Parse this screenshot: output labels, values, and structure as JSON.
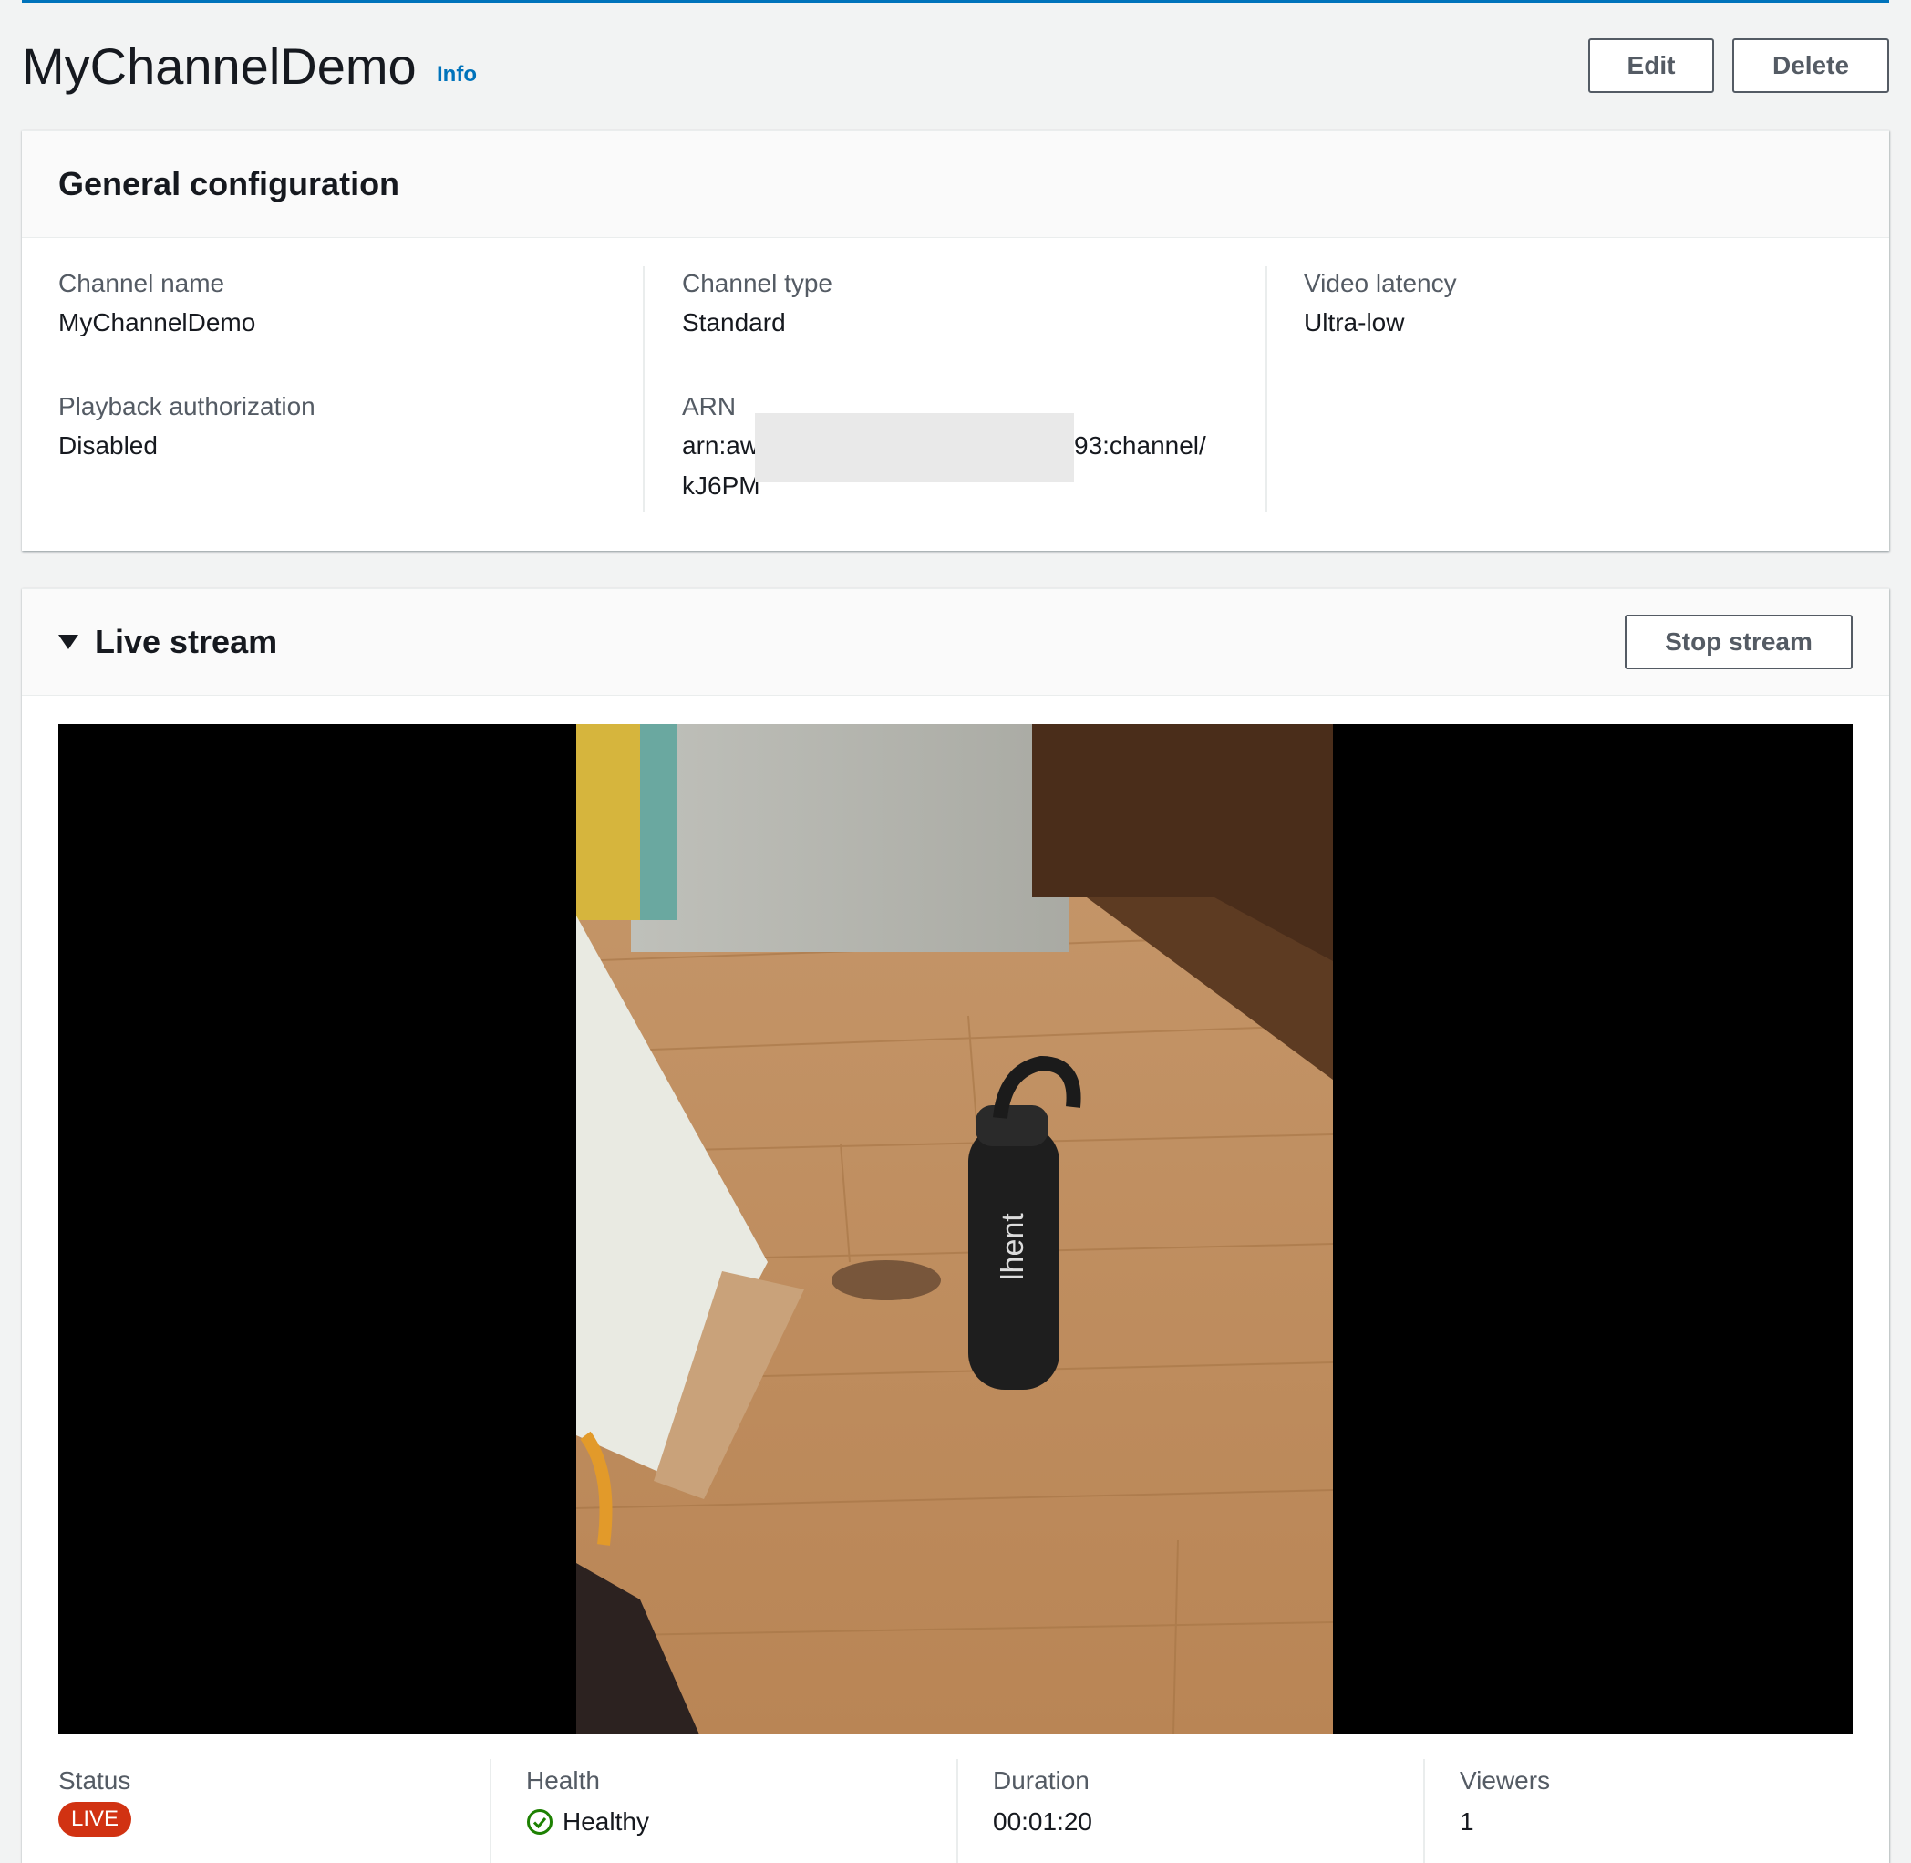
{
  "header": {
    "title": "MyChannelDemo",
    "info_label": "Info",
    "edit_label": "Edit",
    "delete_label": "Delete"
  },
  "general_configuration": {
    "title": "General configuration",
    "channel_name": {
      "label": "Channel name",
      "value": "MyChannelDemo"
    },
    "channel_type": {
      "label": "Channel type",
      "value": "Standard"
    },
    "video_latency": {
      "label": "Video latency",
      "value": "Ultra-low"
    },
    "playback_authorization": {
      "label": "Playback authorization",
      "value": "Disabled"
    },
    "arn": {
      "label": "ARN",
      "value_line1_start": "arn:aw",
      "value_line1_end": "93:channel/",
      "value_line2_start": "kJ6PM"
    }
  },
  "live_stream": {
    "title": "Live stream",
    "stop_label": "Stop stream",
    "status": {
      "label": "Status",
      "value": "LIVE"
    },
    "health": {
      "label": "Health",
      "value": "Healthy"
    },
    "duration": {
      "label": "Duration",
      "value": "00:01:20"
    },
    "viewers": {
      "label": "Viewers",
      "value": "1"
    }
  },
  "colors": {
    "accent": "#0073bb",
    "live_badge": "#d13212",
    "healthy": "#1d8102"
  }
}
